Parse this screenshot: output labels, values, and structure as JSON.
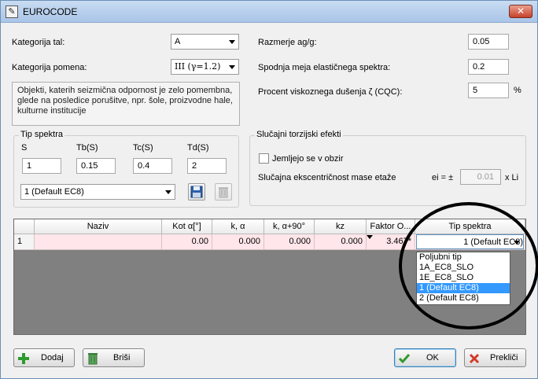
{
  "window": {
    "title": "EUROCODE",
    "close_glyph": "✕"
  },
  "left_form": {
    "kategorija_tal": {
      "label": "Kategorija tal:",
      "value": "A"
    },
    "kategorija_pomena": {
      "label": "Kategorija pomena:",
      "value": "III (γ=1.2)"
    },
    "description": "Objekti, katerih seizmična odpornost je zelo pomembna, glede na posledice porušitve, npr. šole, proizvodne hale, kulturne institucije"
  },
  "right_form": {
    "razmerje": {
      "label": "Razmerje ag/g:",
      "value": "0.05"
    },
    "spodnja_meja": {
      "label": "Spodnja meja elastičnega spektra:",
      "value": "0.2"
    },
    "dusenje": {
      "label": "Procent viskoznega dušenja ζ (CQC):",
      "value": "5",
      "unit": "%"
    }
  },
  "tip_spektra": {
    "title": "Tip spektra",
    "headers": [
      "S",
      "Tb(S)",
      "Tc(S)",
      "Td(S)"
    ],
    "values": [
      "1",
      "0.15",
      "0.4",
      "2"
    ],
    "selected": "1 (Default EC8)"
  },
  "torzija": {
    "title": "Slučajni torzijski efekti",
    "checkbox_label": "Jemljejo se v obzir",
    "eccentricity_label": "Slučajna ekscentričnost mase etaže",
    "ei_label": "ei = ±",
    "ei_value": "0.01",
    "ei_unit": "x Li"
  },
  "table": {
    "headers": [
      "",
      "Naziv",
      "Kot α[°]",
      "k, α",
      "k, α+90°",
      "kz",
      "Faktor O...",
      "Tip spektra"
    ],
    "rows": [
      {
        "num": "1",
        "naziv": "",
        "kot": "0.00",
        "k_alpha": "0.000",
        "k_alpha90": "0.000",
        "kz": "0.000",
        "faktor": "3.467*",
        "tip": "1 (Default EC8)"
      }
    ]
  },
  "dropdown": {
    "options": [
      "Poljubni tip",
      "1A_EC8_SLO",
      "1E_EC8_SLO",
      "1 (Default EC8)",
      "2 (Default EC8)"
    ],
    "selected_index": 3
  },
  "buttons": {
    "dodaj": "Dodaj",
    "brisi": "Briši",
    "ok": "OK",
    "preklici": "Prekliči"
  }
}
